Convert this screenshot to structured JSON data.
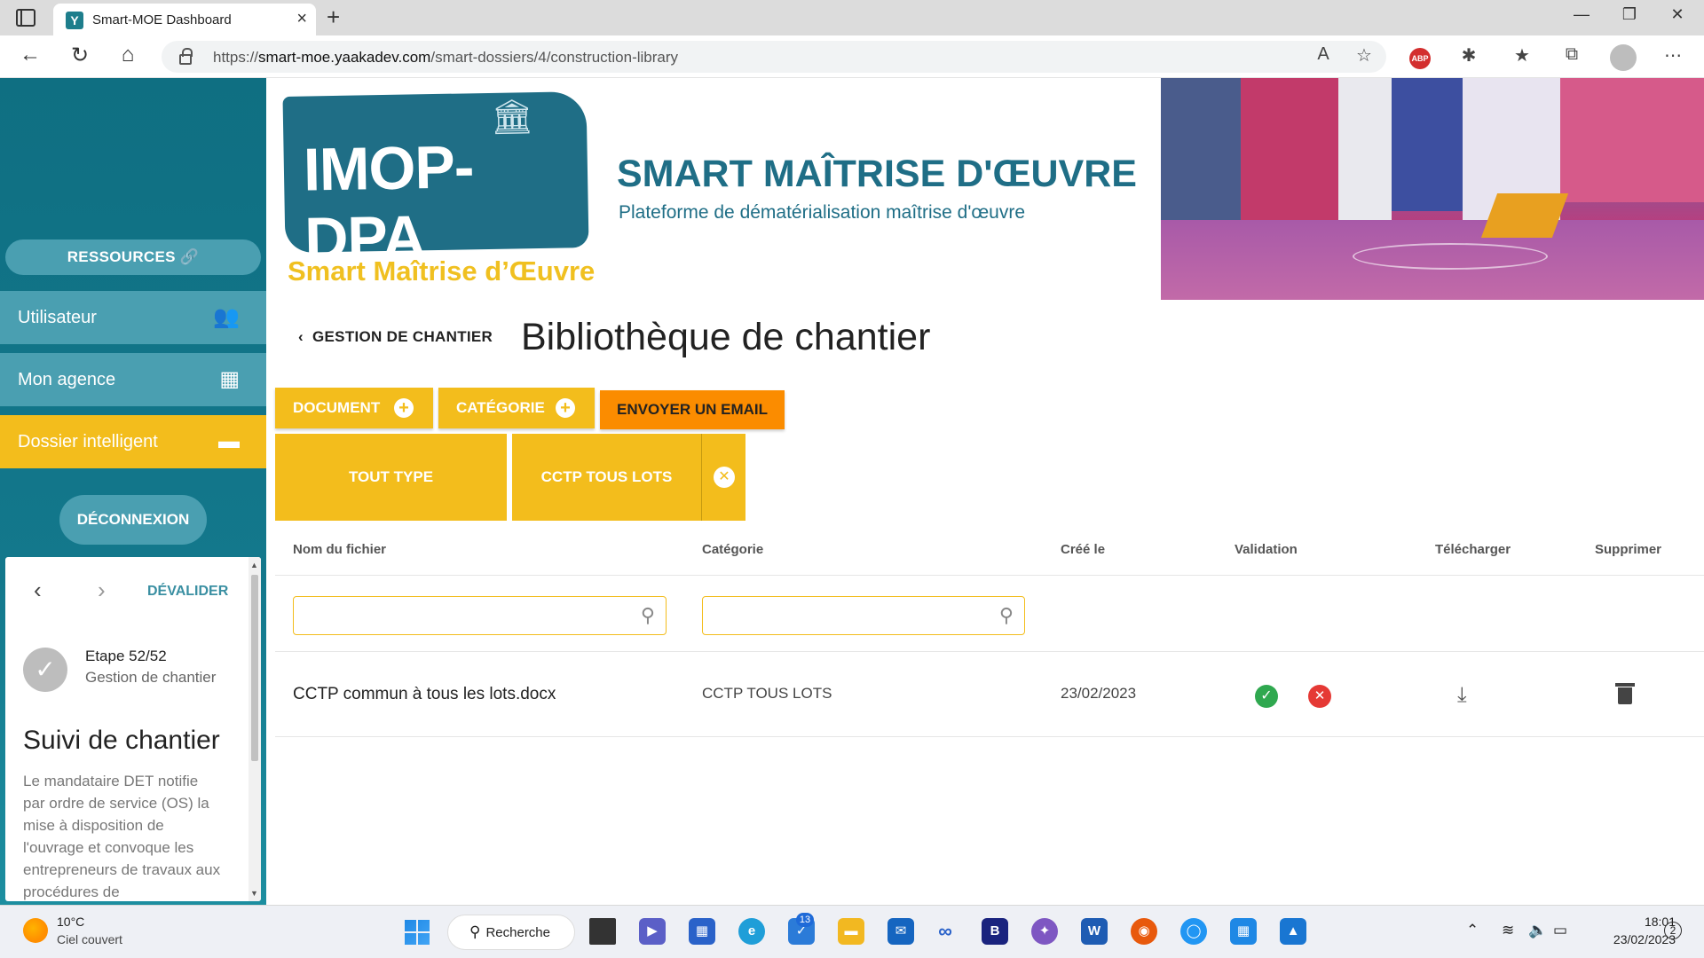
{
  "browser": {
    "tab_title": "Smart-MOE Dashboard",
    "tab_favicon": "Y",
    "url_prefix": "https://",
    "url_host": "smart-moe.yaakadev.com",
    "url_path": "/smart-dossiers/4/construction-library",
    "extension_abp": "ABP"
  },
  "sidebar": {
    "resources_label": "RESSOURCES",
    "menu": [
      {
        "label": "Utilisateur",
        "icon": "users-icon",
        "color": "#4a9fb1"
      },
      {
        "label": "Mon agence",
        "icon": "building-icon",
        "color": "#4a9fb1"
      },
      {
        "label": "Dossier intelligent",
        "icon": "folder-icon",
        "color": "#f3bd1c"
      }
    ],
    "logout_label": "DÉCONNEXION",
    "step_panel": {
      "devalider_label": "DÉVALIDER",
      "step_number": "Etape 52/52",
      "step_subtitle": "Gestion de chantier",
      "title": "Suivi de chantier",
      "description": "Le mandataire DET notifie par ordre de service (OS) la mise à disposition de l'ouvrage et convoque les entrepreneurs de travaux aux procédures de"
    }
  },
  "header": {
    "logo_text": "IMOP-DPA",
    "logo_subtitle": "Smart Maîtrise d’Œuvre",
    "site_title": "SMART MAÎTRISE D'ŒUVRE",
    "site_subtitle": "Plateforme de dématérialisation maîtrise d'œuvre"
  },
  "main": {
    "breadcrumb_back": "GESTION DE CHANTIER",
    "page_title": "Bibliothèque de chantier",
    "actions": {
      "document_label": "DOCUMENT",
      "category_label": "CATÉGORIE",
      "email_label": "ENVOYER UN EMAIL"
    },
    "filters": {
      "type_label": "TOUT TYPE",
      "category_label": "CCTP TOUS LOTS"
    },
    "table": {
      "columns": [
        "Nom du fichier",
        "Catégorie",
        "Créé le",
        "Validation",
        "Télécharger",
        "Supprimer"
      ],
      "search_filename_placeholder": "",
      "search_category_placeholder": "",
      "rows": [
        {
          "filename": "CCTP commun à tous les lots.docx",
          "category": "CCTP TOUS LOTS",
          "created": "23/02/2023"
        }
      ]
    }
  },
  "taskbar": {
    "weather_temp": "10°C",
    "weather_desc": "Ciel couvert",
    "search_label": "Recherche",
    "todo_badge": "13",
    "time": "18:01",
    "date": "23/02/2023",
    "notifications": "2"
  },
  "colors": {
    "teal": "#1f6e86",
    "yellow": "#f3bd1c",
    "orange": "#fb8c00",
    "valid": "#2fa84f",
    "invalid": "#e53935"
  }
}
